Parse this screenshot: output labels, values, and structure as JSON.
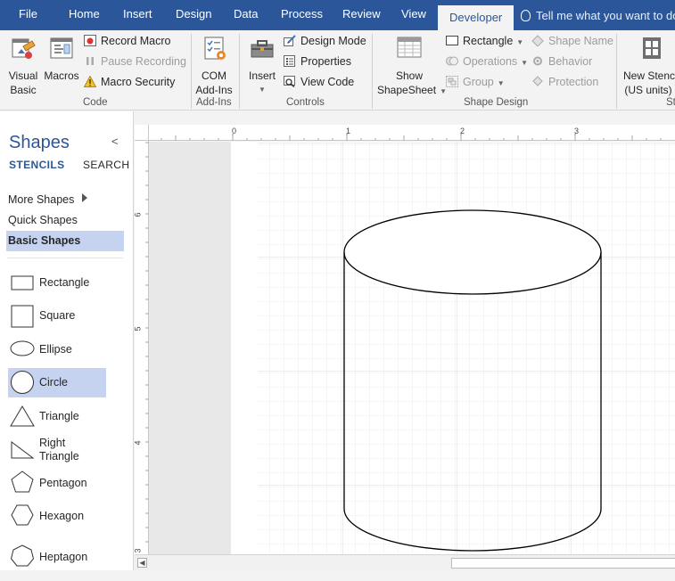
{
  "tabs": [
    "File",
    "Home",
    "Insert",
    "Design",
    "Data",
    "Process",
    "Review",
    "View",
    "Developer"
  ],
  "active_tab": "Developer",
  "tell_me": "Tell me what you want to do...",
  "ribbon": {
    "code": {
      "label": "Code",
      "visual_basic": "Visual\nBasic",
      "macros": "Macros",
      "record_macro": "Record Macro",
      "pause_recording": "Pause Recording",
      "macro_security": "Macro Security"
    },
    "addins": {
      "label": "Add-Ins",
      "com_addins": "COM\nAdd-Ins"
    },
    "controls": {
      "label": "Controls",
      "insert": "Insert",
      "design_mode": "Design Mode",
      "properties": "Properties",
      "view_code": "View Code"
    },
    "shape_design": {
      "label": "Shape Design",
      "show_shapesheet": "Show\nShapeSheet",
      "rectangle": "Rectangle",
      "operations": "Operations",
      "group": "Group",
      "shape_name": "Shape Name",
      "behavior": "Behavior",
      "protection": "Protection"
    },
    "stencil": {
      "new_stencil": "New Stencil\n(US units)"
    }
  },
  "shapes_pane": {
    "title": "Shapes",
    "tabs": [
      "STENCILS",
      "SEARCH"
    ],
    "nav": [
      "More Shapes",
      "Quick Shapes",
      "Basic Shapes"
    ],
    "selected_nav": "Basic Shapes",
    "items": [
      {
        "label": "Rectangle",
        "icon": "rectangle-icon"
      },
      {
        "label": "Square",
        "icon": "square-icon"
      },
      {
        "label": "Ellipse",
        "icon": "ellipse-icon"
      },
      {
        "label": "Circle",
        "icon": "circle-icon"
      },
      {
        "label": "Triangle",
        "icon": "triangle-icon"
      },
      {
        "label": "Right\nTriangle",
        "icon": "right-triangle-icon"
      },
      {
        "label": "Pentagon",
        "icon": "pentagon-icon"
      },
      {
        "label": "Hexagon",
        "icon": "hexagon-icon"
      },
      {
        "label": "Heptagon",
        "icon": "heptagon-icon"
      }
    ],
    "selected_item": "Circle"
  },
  "rulers": {
    "top_labels": [
      "0",
      "1",
      "2",
      "3"
    ],
    "left_labels": [
      "6",
      "5",
      "4",
      "3"
    ]
  },
  "canvas": {
    "shape": "cylinder-shape"
  }
}
